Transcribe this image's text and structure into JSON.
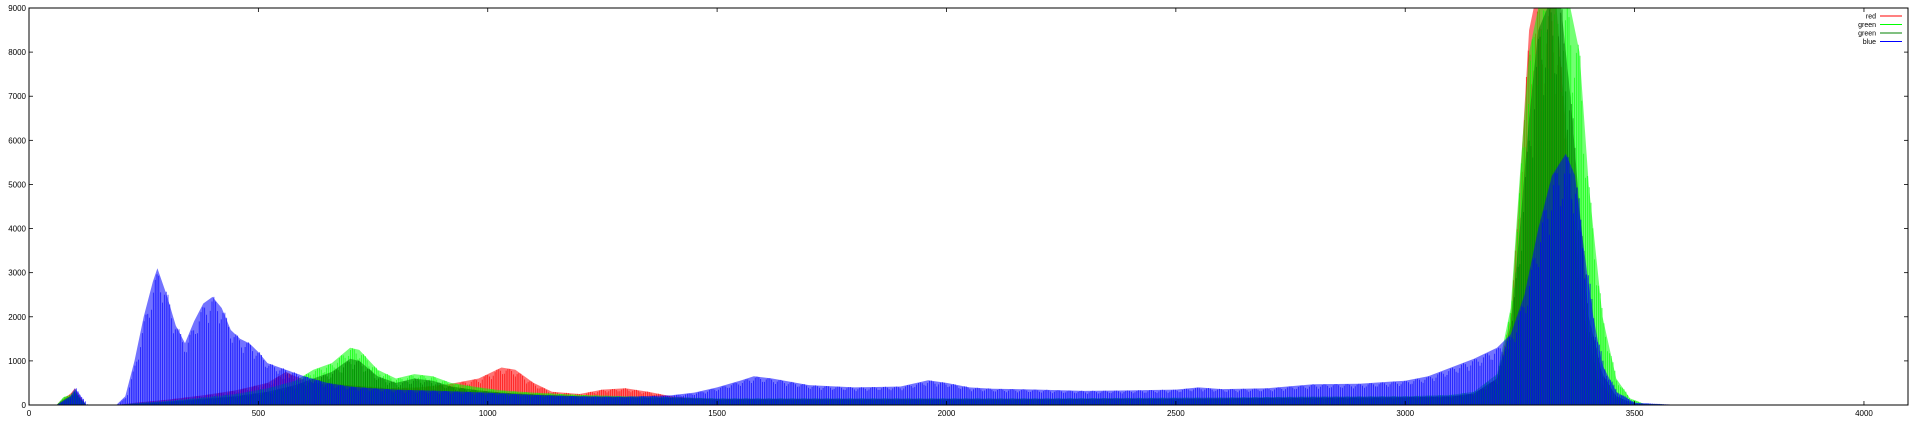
{
  "chart_data": {
    "type": "area",
    "title": "",
    "xlabel": "",
    "ylabel": "",
    "xlim": [
      0,
      4096
    ],
    "ylim": [
      0,
      9000
    ],
    "xticks": [
      0,
      500,
      1000,
      1500,
      2000,
      2500,
      3000,
      3500,
      4000
    ],
    "yticks": [
      0,
      1000,
      2000,
      3000,
      4000,
      5000,
      6000,
      7000,
      8000,
      9000
    ],
    "grid": false,
    "legend_position": "top-right",
    "series": [
      {
        "name": "red",
        "color": "#ff0000",
        "points": [
          [
            0,
            0
          ],
          [
            60,
            0
          ],
          [
            75,
            150
          ],
          [
            90,
            250
          ],
          [
            100,
            380
          ],
          [
            110,
            200
          ],
          [
            125,
            0
          ],
          [
            190,
            0
          ],
          [
            230,
            50
          ],
          [
            300,
            120
          ],
          [
            380,
            220
          ],
          [
            450,
            330
          ],
          [
            520,
            500
          ],
          [
            560,
            750
          ],
          [
            580,
            650
          ],
          [
            620,
            500
          ],
          [
            700,
            450
          ],
          [
            780,
            380
          ],
          [
            850,
            400
          ],
          [
            920,
            480
          ],
          [
            980,
            600
          ],
          [
            1030,
            850
          ],
          [
            1060,
            800
          ],
          [
            1100,
            500
          ],
          [
            1140,
            300
          ],
          [
            1200,
            250
          ],
          [
            1250,
            350
          ],
          [
            1300,
            380
          ],
          [
            1350,
            300
          ],
          [
            1400,
            200
          ],
          [
            1450,
            150
          ],
          [
            1500,
            130
          ],
          [
            1600,
            130
          ],
          [
            1800,
            130
          ],
          [
            2000,
            130
          ],
          [
            2200,
            130
          ],
          [
            2400,
            140
          ],
          [
            2600,
            150
          ],
          [
            2800,
            160
          ],
          [
            3000,
            170
          ],
          [
            3100,
            190
          ],
          [
            3150,
            260
          ],
          [
            3200,
            600
          ],
          [
            3230,
            2000
          ],
          [
            3250,
            5000
          ],
          [
            3270,
            8500
          ],
          [
            3280,
            9000
          ],
          [
            3330,
            9000
          ],
          [
            3360,
            5000
          ],
          [
            3390,
            2000
          ],
          [
            3420,
            600
          ],
          [
            3450,
            200
          ],
          [
            3480,
            50
          ],
          [
            3500,
            20
          ],
          [
            3600,
            0
          ],
          [
            4096,
            0
          ]
        ]
      },
      {
        "name": "green",
        "color": "#00ff00",
        "points": [
          [
            0,
            0
          ],
          [
            60,
            0
          ],
          [
            75,
            180
          ],
          [
            90,
            230
          ],
          [
            100,
            330
          ],
          [
            110,
            160
          ],
          [
            125,
            0
          ],
          [
            190,
            0
          ],
          [
            230,
            40
          ],
          [
            300,
            90
          ],
          [
            380,
            170
          ],
          [
            450,
            250
          ],
          [
            520,
            380
          ],
          [
            580,
            550
          ],
          [
            620,
            800
          ],
          [
            660,
            950
          ],
          [
            700,
            1300
          ],
          [
            720,
            1250
          ],
          [
            760,
            800
          ],
          [
            800,
            600
          ],
          [
            840,
            700
          ],
          [
            880,
            650
          ],
          [
            920,
            500
          ],
          [
            980,
            400
          ],
          [
            1030,
            330
          ],
          [
            1100,
            280
          ],
          [
            1200,
            230
          ],
          [
            1300,
            200
          ],
          [
            1400,
            180
          ],
          [
            1500,
            150
          ],
          [
            1600,
            150
          ],
          [
            1800,
            150
          ],
          [
            2000,
            150
          ],
          [
            2200,
            150
          ],
          [
            2400,
            160
          ],
          [
            2600,
            170
          ],
          [
            2800,
            190
          ],
          [
            3000,
            200
          ],
          [
            3100,
            230
          ],
          [
            3150,
            300
          ],
          [
            3200,
            700
          ],
          [
            3230,
            2200
          ],
          [
            3250,
            5200
          ],
          [
            3270,
            8000
          ],
          [
            3290,
            9000
          ],
          [
            3360,
            9000
          ],
          [
            3380,
            8000
          ],
          [
            3400,
            5000
          ],
          [
            3430,
            2000
          ],
          [
            3460,
            600
          ],
          [
            3490,
            150
          ],
          [
            3520,
            30
          ],
          [
            3600,
            0
          ],
          [
            4096,
            0
          ]
        ]
      },
      {
        "name": "green",
        "color": "#008000",
        "points": [
          [
            0,
            0
          ],
          [
            60,
            0
          ],
          [
            75,
            120
          ],
          [
            90,
            200
          ],
          [
            100,
            300
          ],
          [
            110,
            140
          ],
          [
            125,
            0
          ],
          [
            190,
            0
          ],
          [
            230,
            30
          ],
          [
            300,
            70
          ],
          [
            380,
            140
          ],
          [
            450,
            200
          ],
          [
            520,
            300
          ],
          [
            580,
            450
          ],
          [
            620,
            600
          ],
          [
            660,
            750
          ],
          [
            700,
            1050
          ],
          [
            720,
            1000
          ],
          [
            760,
            650
          ],
          [
            800,
            500
          ],
          [
            840,
            600
          ],
          [
            880,
            550
          ],
          [
            920,
            420
          ],
          [
            980,
            330
          ],
          [
            1030,
            280
          ],
          [
            1100,
            240
          ],
          [
            1200,
            200
          ],
          [
            1300,
            180
          ],
          [
            1400,
            160
          ],
          [
            1500,
            130
          ],
          [
            1600,
            130
          ],
          [
            1800,
            130
          ],
          [
            2000,
            130
          ],
          [
            2200,
            130
          ],
          [
            2400,
            140
          ],
          [
            2600,
            150
          ],
          [
            2800,
            170
          ],
          [
            3000,
            180
          ],
          [
            3100,
            200
          ],
          [
            3150,
            260
          ],
          [
            3200,
            600
          ],
          [
            3230,
            1800
          ],
          [
            3250,
            4000
          ],
          [
            3270,
            6500
          ],
          [
            3290,
            8500
          ],
          [
            3310,
            9000
          ],
          [
            3340,
            9000
          ],
          [
            3360,
            7000
          ],
          [
            3380,
            4500
          ],
          [
            3400,
            2000
          ],
          [
            3430,
            700
          ],
          [
            3460,
            200
          ],
          [
            3500,
            30
          ],
          [
            3600,
            0
          ],
          [
            4096,
            0
          ]
        ]
      },
      {
        "name": "blue",
        "color": "#0000ff",
        "points": [
          [
            0,
            0
          ],
          [
            60,
            0
          ],
          [
            75,
            100
          ],
          [
            90,
            200
          ],
          [
            100,
            380
          ],
          [
            110,
            250
          ],
          [
            125,
            0
          ],
          [
            190,
            0
          ],
          [
            210,
            200
          ],
          [
            230,
            1000
          ],
          [
            250,
            2000
          ],
          [
            270,
            2800
          ],
          [
            280,
            3100
          ],
          [
            300,
            2500
          ],
          [
            320,
            1800
          ],
          [
            340,
            1400
          ],
          [
            360,
            1900
          ],
          [
            380,
            2300
          ],
          [
            400,
            2450
          ],
          [
            420,
            2200
          ],
          [
            440,
            1700
          ],
          [
            460,
            1500
          ],
          [
            480,
            1400
          ],
          [
            500,
            1200
          ],
          [
            520,
            950
          ],
          [
            560,
            800
          ],
          [
            600,
            650
          ],
          [
            650,
            500
          ],
          [
            700,
            420
          ],
          [
            750,
            380
          ],
          [
            800,
            350
          ],
          [
            900,
            320
          ],
          [
            1000,
            280
          ],
          [
            1100,
            230
          ],
          [
            1200,
            200
          ],
          [
            1300,
            190
          ],
          [
            1400,
            220
          ],
          [
            1450,
            280
          ],
          [
            1500,
            400
          ],
          [
            1550,
            550
          ],
          [
            1580,
            650
          ],
          [
            1620,
            600
          ],
          [
            1700,
            450
          ],
          [
            1800,
            400
          ],
          [
            1900,
            420
          ],
          [
            1960,
            560
          ],
          [
            2000,
            500
          ],
          [
            2050,
            400
          ],
          [
            2100,
            370
          ],
          [
            2200,
            350
          ],
          [
            2300,
            320
          ],
          [
            2400,
            330
          ],
          [
            2500,
            350
          ],
          [
            2550,
            400
          ],
          [
            2600,
            360
          ],
          [
            2700,
            380
          ],
          [
            2800,
            470
          ],
          [
            2900,
            480
          ],
          [
            3000,
            550
          ],
          [
            3050,
            650
          ],
          [
            3100,
            850
          ],
          [
            3150,
            1050
          ],
          [
            3200,
            1300
          ],
          [
            3230,
            1600
          ],
          [
            3260,
            2500
          ],
          [
            3290,
            4000
          ],
          [
            3320,
            5200
          ],
          [
            3350,
            5700
          ],
          [
            3370,
            5200
          ],
          [
            3390,
            3500
          ],
          [
            3410,
            2000
          ],
          [
            3430,
            900
          ],
          [
            3460,
            300
          ],
          [
            3500,
            50
          ],
          [
            3600,
            0
          ],
          [
            4096,
            0
          ]
        ]
      }
    ]
  }
}
